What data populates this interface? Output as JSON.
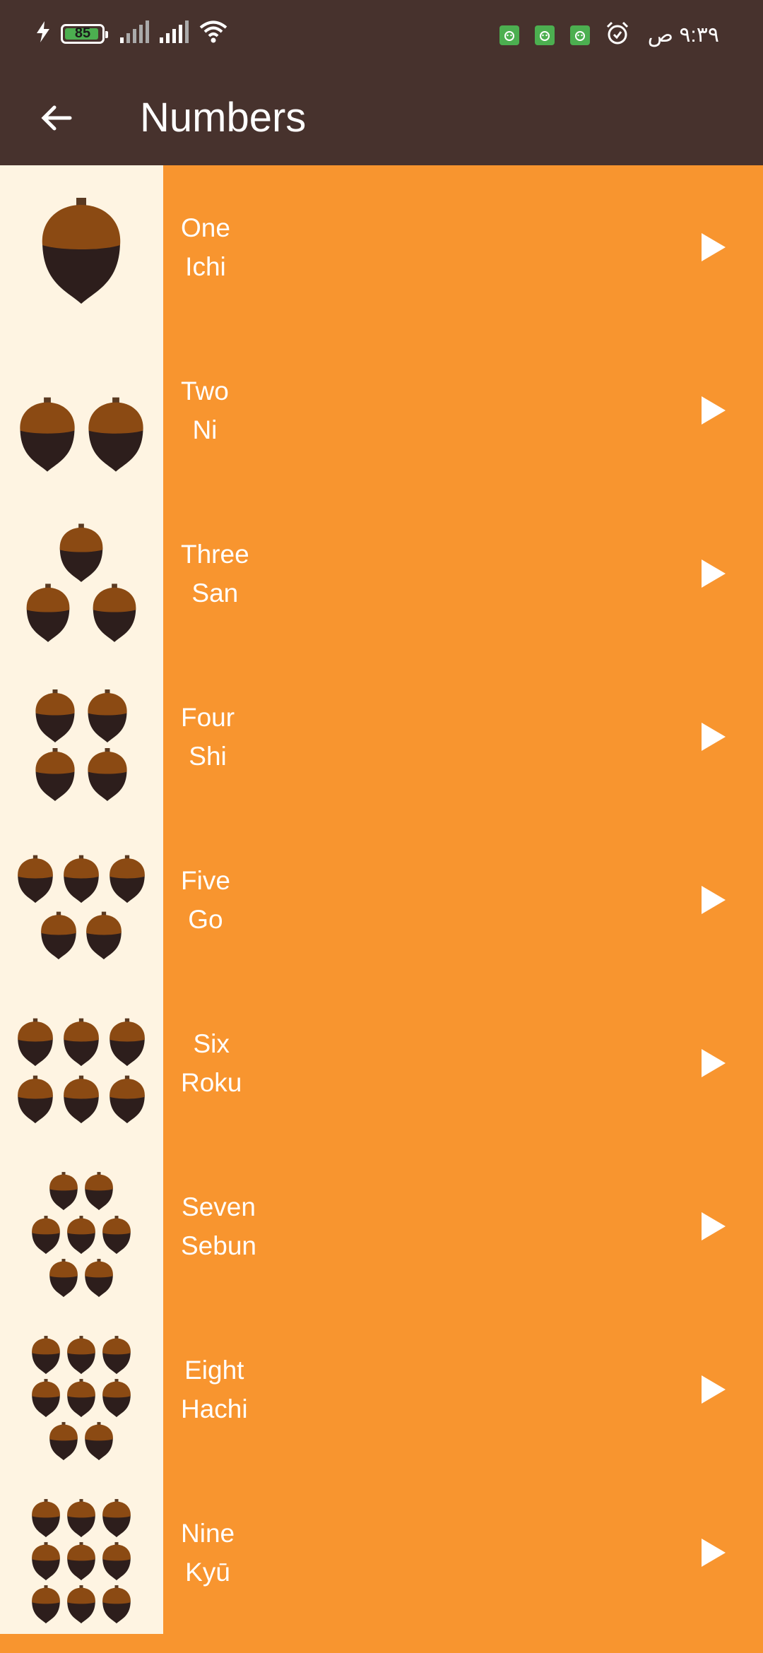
{
  "status_bar": {
    "battery_level": "85",
    "time": "٩:٣٩ ص",
    "icons": [
      "charging-bolt-icon",
      "battery-icon",
      "signal-icon",
      "signal-icon",
      "wifi-icon",
      "app-notification-icon",
      "app-notification-icon",
      "app-notification-icon",
      "alarm-icon"
    ]
  },
  "app_bar": {
    "title": "Numbers",
    "back_icon": "arrow-left-icon",
    "color": "#47322D"
  },
  "colors": {
    "row_bg": "#F8952F",
    "thumb_bg": "#FEF4E2",
    "acorn_cap": "#8B4A13",
    "acorn_body": "#2D1E1C"
  },
  "numbers": [
    {
      "english": "One",
      "japanese": "Ichi",
      "count": 1
    },
    {
      "english": "Two",
      "japanese": "Ni",
      "count": 2
    },
    {
      "english": "Three",
      "japanese": "San",
      "count": 3
    },
    {
      "english": "Four",
      "japanese": "Shi",
      "count": 4
    },
    {
      "english": "Five",
      "japanese": "Go",
      "count": 5
    },
    {
      "english": "Six",
      "japanese": "Roku",
      "count": 6
    },
    {
      "english": "Seven",
      "japanese": "Sebun",
      "count": 7
    },
    {
      "english": "Eight",
      "japanese": "Hachi",
      "count": 8
    },
    {
      "english": "Nine",
      "japanese": "Kyū",
      "count": 9
    }
  ]
}
